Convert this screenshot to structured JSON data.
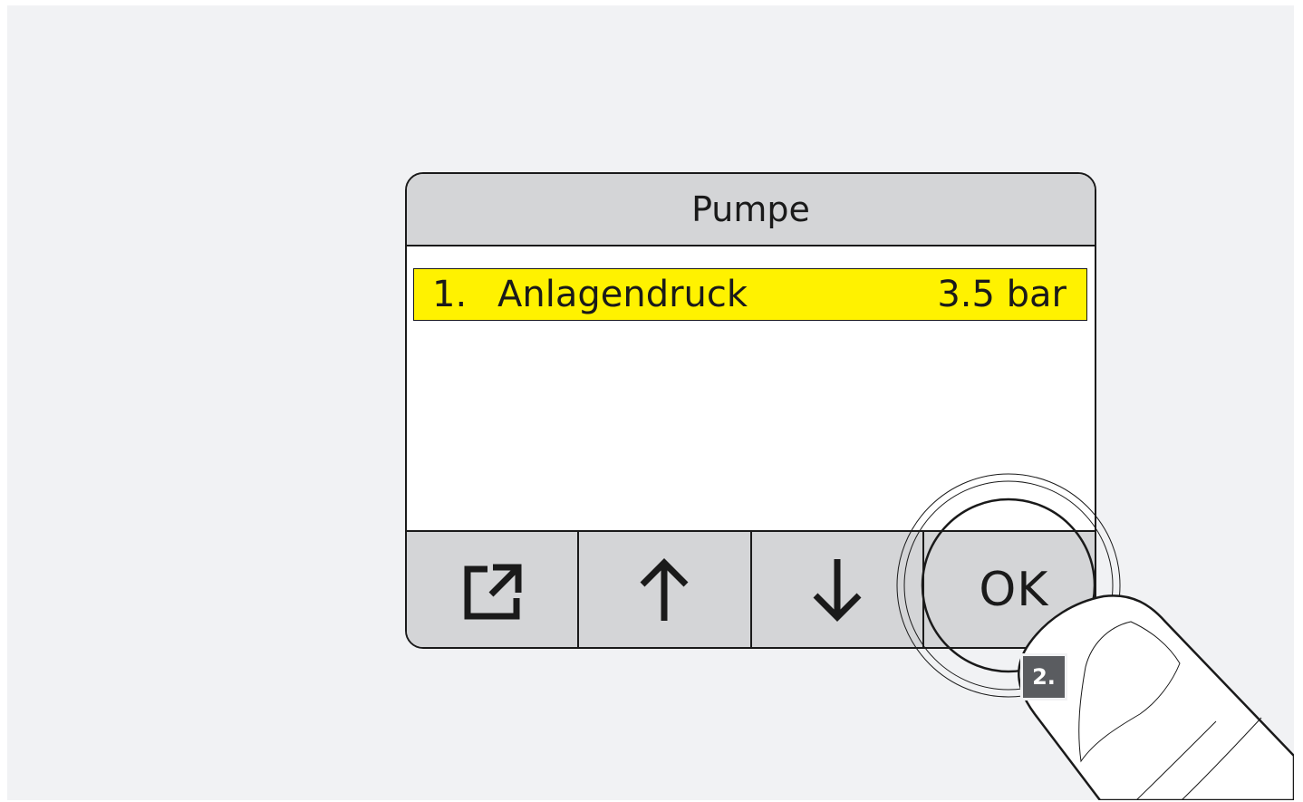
{
  "screen": {
    "title": "Pumpe"
  },
  "menu": {
    "items": [
      {
        "number": "1.",
        "label": "Anlagendruck",
        "value": "3.5 bar",
        "selected": true
      }
    ]
  },
  "softkeys": {
    "exit_icon": "exit-icon",
    "up_icon": "arrow-up-icon",
    "down_icon": "arrow-down-icon",
    "ok_label": "OK"
  },
  "instruction": {
    "step_label": "2."
  },
  "colors": {
    "highlight": "#fff200",
    "bar_gray": "#d4d5d7",
    "badge": "#5a5c60"
  }
}
